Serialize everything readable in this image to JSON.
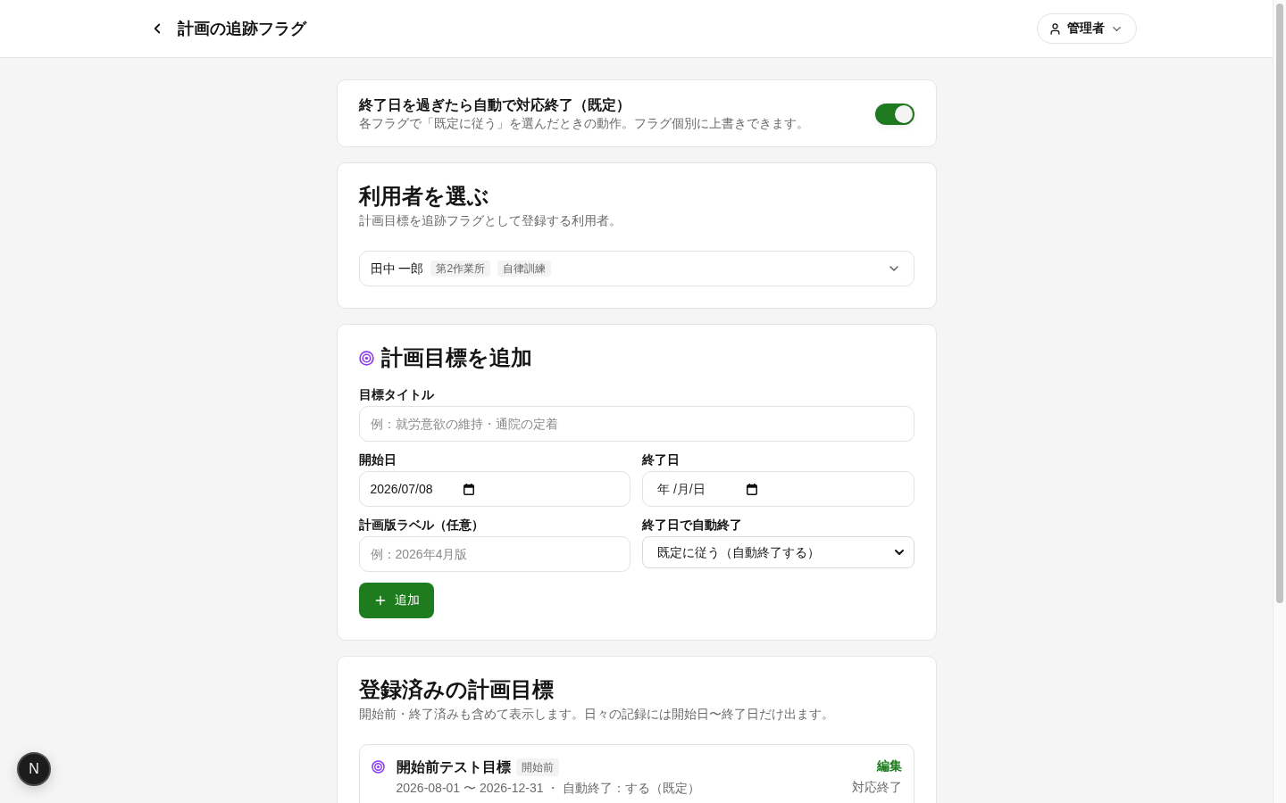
{
  "header": {
    "title": "計画の追跡フラグ",
    "user_menu": {
      "label": "管理者"
    }
  },
  "auto_close_default": {
    "title": "終了日を過ぎたら自動で対応終了（既定）",
    "description": "各フラグで「既定に従う」を選んだときの動作。フラグ個別に上書きできます。",
    "on": true
  },
  "user_picker": {
    "title": "利用者を選ぶ",
    "description": "計画目標を追跡フラグとして登録する利用者。",
    "selected_user": {
      "name": "田中 一郎",
      "tags": [
        "第2作業所",
        "自律訓練"
      ]
    }
  },
  "add_goal": {
    "title": "計画目標を追加",
    "goal_title": {
      "label": "目標タイトル",
      "placeholder": "例：就労意欲の維持・通院の定着"
    },
    "fields": [
      {
        "kind": "date",
        "label": "開始日",
        "value": "2026/07/08"
      },
      {
        "kind": "date",
        "label": "終了日",
        "placeholder": "年 /月/日"
      },
      {
        "kind": "text",
        "label": "計画版ラベル（任意）",
        "placeholder": "例：2026年4月版"
      },
      {
        "kind": "select",
        "label": "終了日で自動終了",
        "value": "既定に従う（自動終了する）"
      }
    ],
    "submit": {
      "label": "追加"
    }
  },
  "registered_goals": {
    "title": "登録済みの計画目標",
    "description": "開始前・終了済みも含めて表示します。日々の記録には開始日〜終了日だけ出ます。",
    "items": [
      {
        "title": "開始前テスト目標",
        "status": "開始前",
        "meta": "2026-08-01 〜 2026-12-31 ・ 自動終了：する（既定）",
        "edit_label": "編集",
        "finish_label": "対応終了"
      }
    ]
  },
  "dev_badge": {
    "label": "N"
  }
}
